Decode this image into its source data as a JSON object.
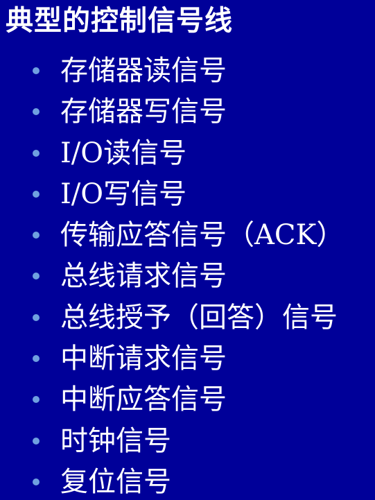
{
  "slide": {
    "title": "典型的控制信号线",
    "background_color": "#000099",
    "bullet_color": "#6fa0e0",
    "text_color": "#ffffff",
    "items": [
      "存储器读信号",
      "存储器写信号",
      "I/O读信号",
      "I/O写信号",
      "传输应答信号（ACK）",
      "总线请求信号",
      "总线授予（回答）信号",
      "中断请求信号",
      "中断应答信号",
      "时钟信号",
      "复位信号"
    ]
  }
}
